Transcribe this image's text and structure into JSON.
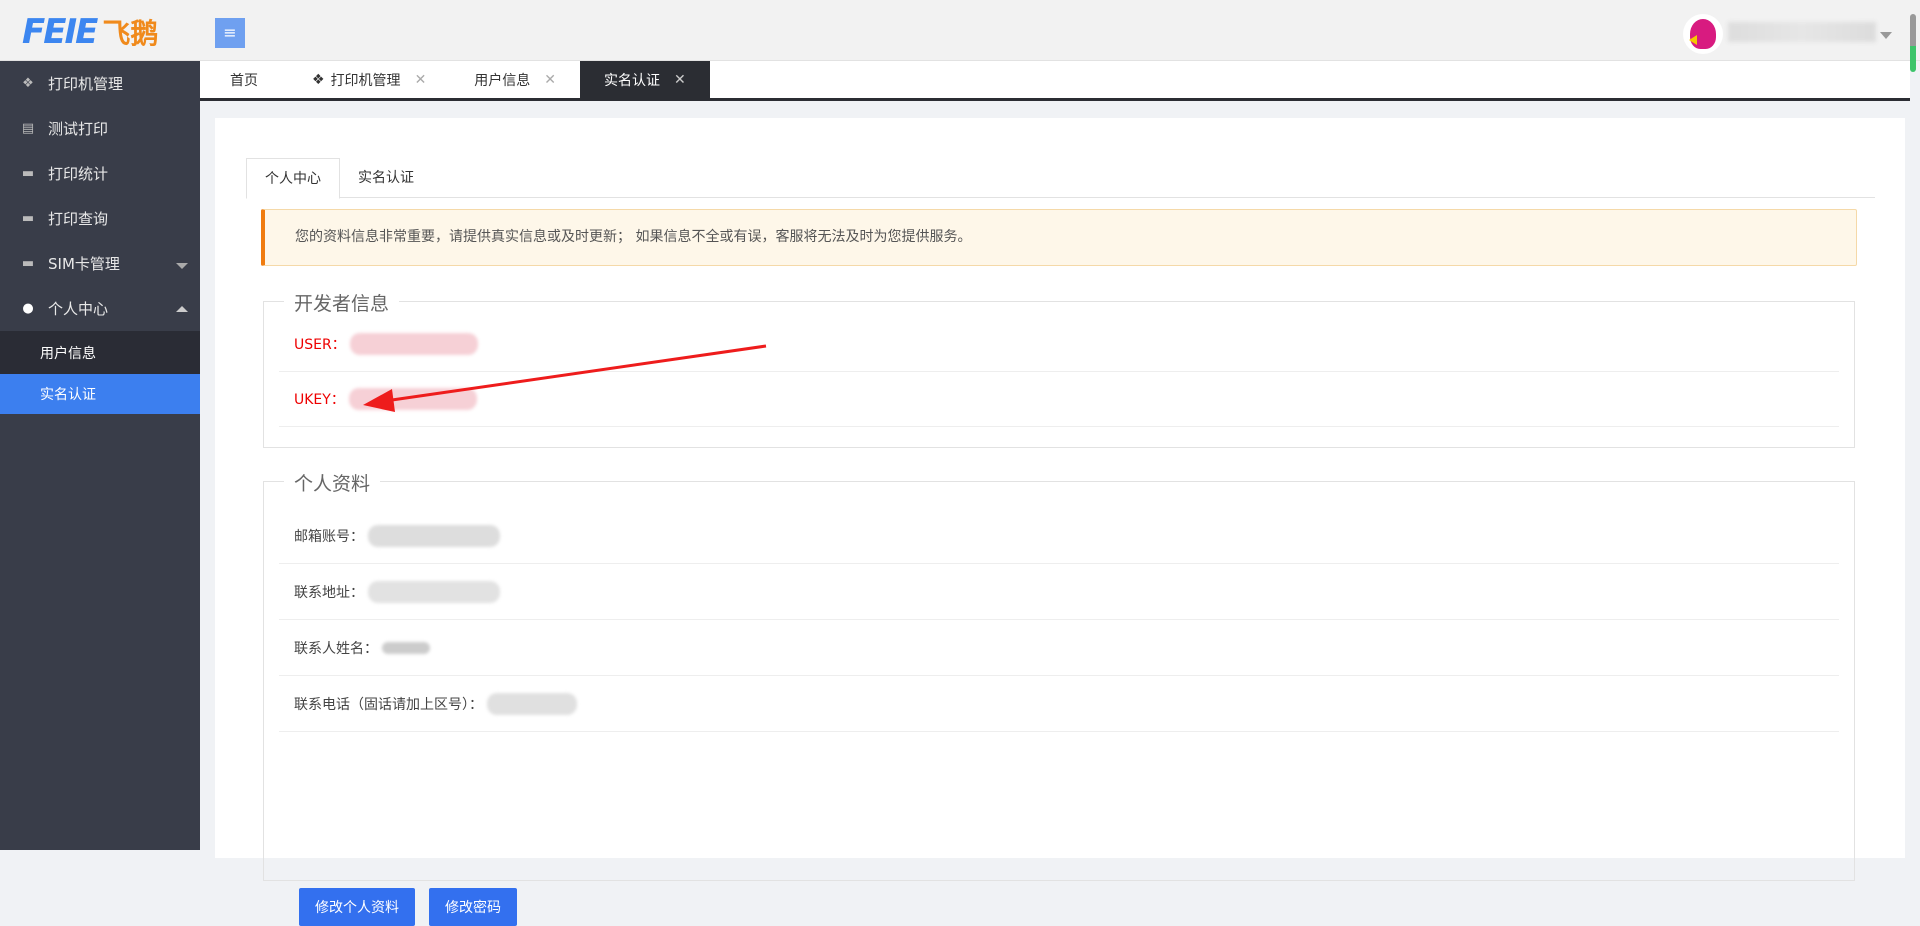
{
  "header": {
    "logo_en": "FEIE",
    "logo_cn": "飞鹅",
    "menu_icon": "≡"
  },
  "sidebar": {
    "items": [
      {
        "label": "打印机管理",
        "icon": "cubes-icon"
      },
      {
        "label": "测试打印",
        "icon": "file-icon"
      },
      {
        "label": "打印统计",
        "icon": "monitor-icon"
      },
      {
        "label": "打印查询",
        "icon": "monitor-icon"
      },
      {
        "label": "SIM卡管理",
        "icon": "monitor-icon"
      },
      {
        "label": "个人中心",
        "icon": "user-icon"
      }
    ],
    "sub_items": [
      {
        "label": "用户信息"
      },
      {
        "label": "实名认证"
      }
    ]
  },
  "tabs": [
    {
      "label": "首页"
    },
    {
      "label": "打印机管理"
    },
    {
      "label": "用户信息"
    },
    {
      "label": "实名认证"
    }
  ],
  "close_glyph": "✕",
  "inner_tabs": [
    {
      "label": "个人中心"
    },
    {
      "label": "实名认证"
    }
  ],
  "alert": "您的资料信息非常重要，请提供真实信息或及时更新； 如果信息不全或有误，客服将无法及时为您提供服务。",
  "developer": {
    "legend": "开发者信息",
    "user_label": "USER：",
    "ukey_label": "UKEY："
  },
  "profile": {
    "legend": "个人资料",
    "email_label": "邮箱账号：",
    "address_label": "联系地址：",
    "name_label": "联系人姓名：",
    "phone_label": "联系电话（固话请加上区号）："
  },
  "buttons": {
    "edit_profile": "修改个人资料",
    "change_password": "修改密码"
  },
  "colors": {
    "sidebar": "#393d49",
    "accent": "#3c7fef",
    "warning": "#f07c10",
    "button": "#3370ef"
  }
}
